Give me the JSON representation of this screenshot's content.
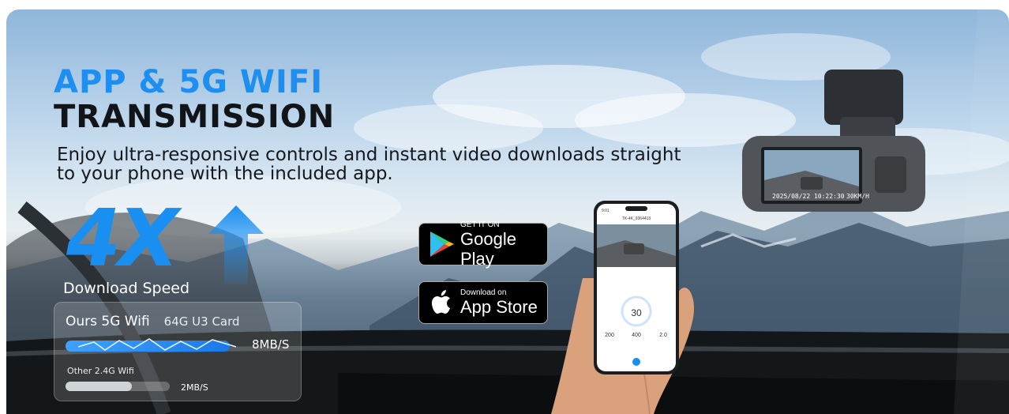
{
  "headline": {
    "line1": "APP & 5G WIFI",
    "line2": "TRANSMISSION",
    "subtitle": "Enjoy ultra-responsive controls and instant video downloads straight to your phone with the included app."
  },
  "speed": {
    "multiplier": "4X",
    "label": "Download Speed"
  },
  "comparison": {
    "ours_label": "Ours 5G Wifi",
    "card_label": "64G U3 Card",
    "ours_value": "8MB/S",
    "other_label": "Other 2.4G Wifi",
    "other_value": "2MB/S"
  },
  "badges": {
    "google_small": "GET IT ON",
    "google_big": "Google Play",
    "apple_small": "Download on",
    "apple_big": "App Store"
  },
  "phone_screen": {
    "status_time": "9:01",
    "device_name": "TK-4K_9364413",
    "speed_value": "30",
    "stat_left": "200",
    "stat_mid": "400",
    "stat_right": "2.0"
  },
  "dashcam_screen": {
    "timestamp": "2025/08/22 10:22:30",
    "speed_text": "30KM/H"
  },
  "colors": {
    "accent_blue": "#1e8ef0",
    "dark_text": "#111418"
  }
}
